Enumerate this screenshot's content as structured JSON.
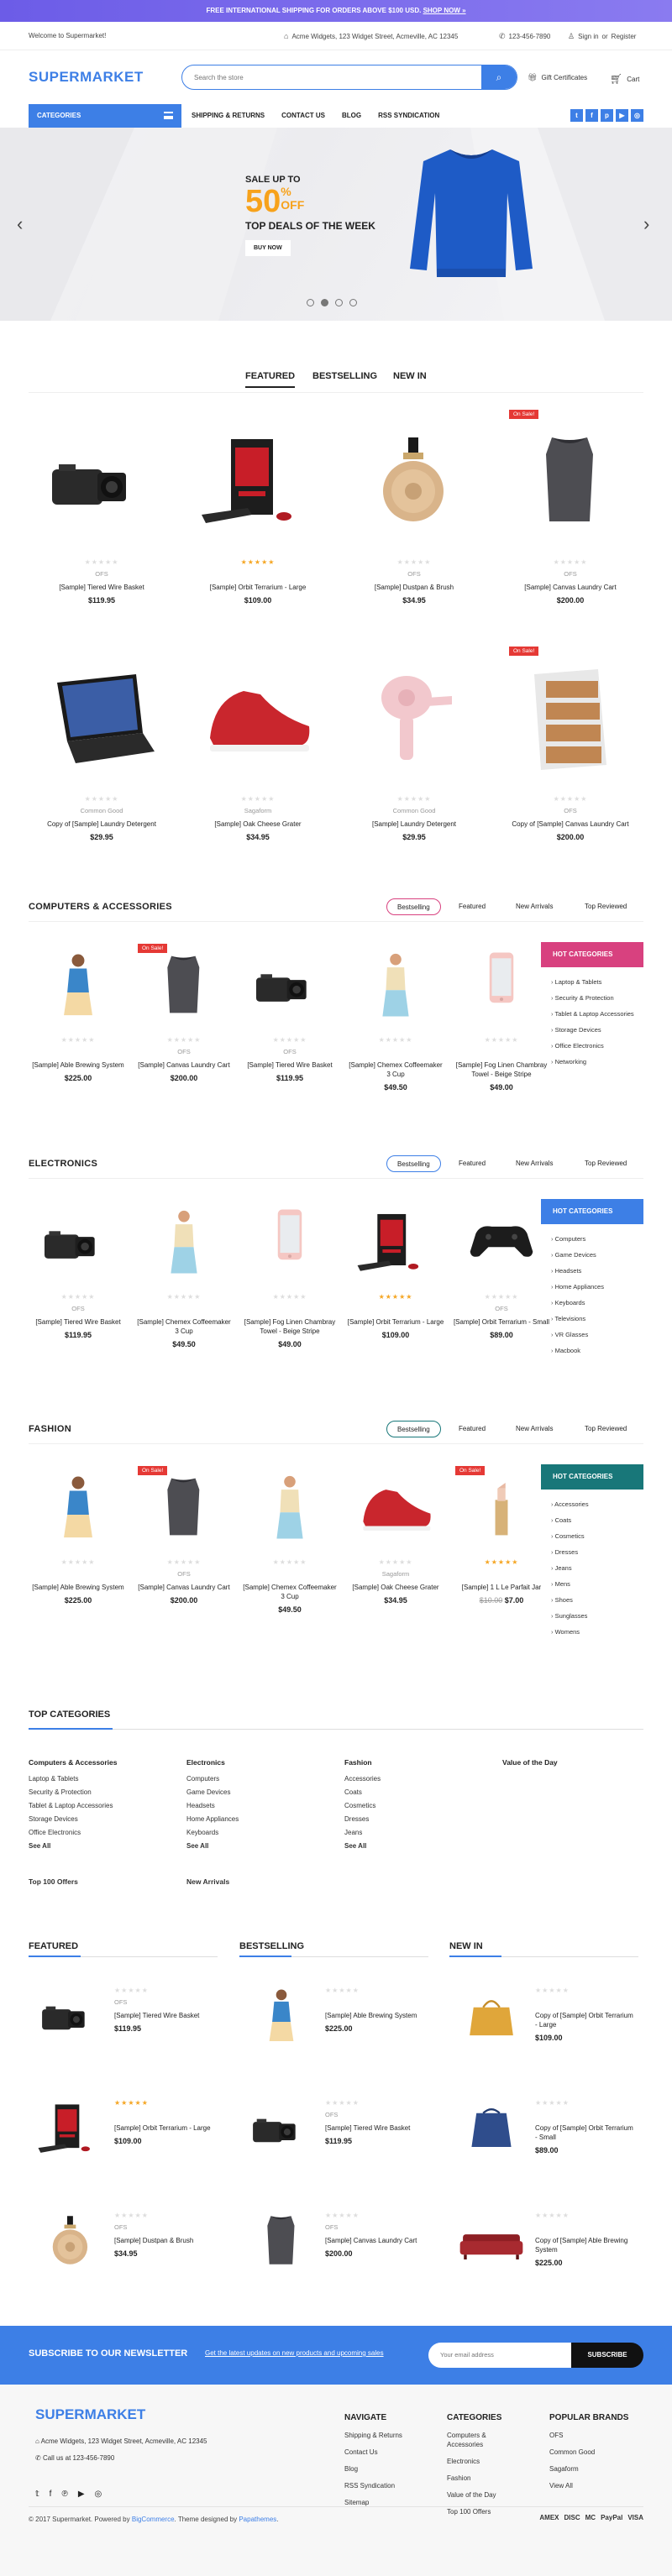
{
  "promo": {
    "text": "FREE INTERNATIONAL SHIPPING FOR ORDERS ABOVE $100 USD.",
    "link": "SHOP NOW »"
  },
  "topbar": {
    "welcome": "Welcome to Supermarket!",
    "address": "Acme Widgets, 123 Widget Street, Acmeville, AC 12345",
    "phone": "123-456-7890",
    "signin": "Sign in",
    "or": "or",
    "register": "Register"
  },
  "header": {
    "logo": "SUPERMARKET",
    "search_placeholder": "Search the store",
    "gift": "Gift Certificates"
  },
  "nav": {
    "categories": "CATEGORIES",
    "links": [
      "SHIPPING & RETURNS",
      "CONTACT US",
      "BLOG",
      "RSS SYNDICATION"
    ]
  },
  "hero": {
    "line1": "SALE UP TO",
    "pct": "50",
    "percent": "%",
    "off": "OFF",
    "line3": "TOP DEALS OF THE WEEK",
    "btn": "BUY NOW"
  },
  "tabs": [
    "FEATURED",
    "BESTSELLING",
    "NEW IN"
  ],
  "featured": [
    {
      "brand": "OFS",
      "name": "[Sample] Tiered Wire Basket",
      "price": "$119.95",
      "stars": "★★★★★",
      "starcolor": "grey",
      "img": "camera",
      "sale": ""
    },
    {
      "brand": "",
      "name": "[Sample] Orbit Terrarium - Large",
      "price": "$109.00",
      "stars": "★★★★★",
      "starcolor": "yellow",
      "img": "pc",
      "sale": ""
    },
    {
      "brand": "OFS",
      "name": "[Sample] Dustpan & Brush",
      "price": "$34.95",
      "stars": "★★★★★",
      "starcolor": "grey",
      "img": "perfume",
      "sale": ""
    },
    {
      "brand": "OFS",
      "name": "[Sample] Canvas Laundry Cart",
      "price": "$200.00",
      "stars": "★★★★★",
      "starcolor": "grey",
      "img": "shirt",
      "sale": "On Sale!"
    },
    {
      "brand": "Common Good",
      "name": "Copy of [Sample] Laundry Detergent",
      "price": "$29.95",
      "stars": "★★★★★",
      "starcolor": "grey",
      "img": "laptop",
      "sale": ""
    },
    {
      "brand": "Sagaform",
      "name": "[Sample] Oak Cheese Grater",
      "price": "$34.95",
      "stars": "★★★★★",
      "starcolor": "grey",
      "img": "shoe",
      "sale": ""
    },
    {
      "brand": "Common Good",
      "name": "[Sample] Laundry Detergent",
      "price": "$29.95",
      "stars": "★★★★★",
      "starcolor": "grey",
      "img": "dryer",
      "sale": ""
    },
    {
      "brand": "OFS",
      "name": "Copy of [Sample] Canvas Laundry Cart",
      "price": "$200.00",
      "stars": "★★★★★",
      "starcolor": "grey",
      "img": "drawers",
      "sale": "On Sale!"
    }
  ],
  "filters": [
    "Bestselling",
    "Featured",
    "New Arrivals",
    "Top Reviewed"
  ],
  "sections": [
    {
      "title": "COMPUTERS & ACCESSORIES",
      "color": "#d8417f",
      "box_title": "HOT CATEGORIES",
      "products": [
        {
          "brand": "",
          "name": "[Sample] Able Brewing System",
          "price": "$225.00",
          "old": "",
          "img": "woman",
          "sale": "",
          "starcolor": "grey"
        },
        {
          "brand": "OFS",
          "name": "[Sample] Canvas Laundry Cart",
          "price": "$200.00",
          "old": "",
          "img": "shirt",
          "sale": "On Sale!",
          "starcolor": "grey"
        },
        {
          "brand": "OFS",
          "name": "[Sample] Tiered Wire Basket",
          "price": "$119.95",
          "old": "",
          "img": "camera",
          "sale": "",
          "starcolor": "grey"
        },
        {
          "brand": "",
          "name": "[Sample] Chemex Coffeemaker 3 Cup",
          "price": "$49.50",
          "old": "",
          "img": "woman2",
          "sale": "",
          "starcolor": "grey"
        },
        {
          "brand": "",
          "name": "[Sample] Fog Linen Chambray Towel - Beige Stripe",
          "price": "$49.00",
          "old": "",
          "img": "phone",
          "sale": "",
          "starcolor": "grey"
        }
      ],
      "cats": [
        "Laptop & Tablets",
        "Security & Protection",
        "Tablet & Laptop Accessories",
        "Storage Devices",
        "Office Electronics",
        "Networking"
      ]
    },
    {
      "title": "ELECTRONICS",
      "color": "#3d7fe6",
      "box_title": "HOT CATEGORIES",
      "products": [
        {
          "brand": "OFS",
          "name": "[Sample] Tiered Wire Basket",
          "price": "$119.95",
          "old": "",
          "img": "camera",
          "sale": "",
          "starcolor": "grey"
        },
        {
          "brand": "",
          "name": "[Sample] Chemex Coffeemaker 3 Cup",
          "price": "$49.50",
          "old": "",
          "img": "woman2",
          "sale": "",
          "starcolor": "grey"
        },
        {
          "brand": "",
          "name": "[Sample] Fog Linen Chambray Towel - Beige Stripe",
          "price": "$49.00",
          "old": "",
          "img": "phone",
          "sale": "",
          "starcolor": "grey"
        },
        {
          "brand": "",
          "name": "[Sample] Orbit Terrarium - Large",
          "price": "$109.00",
          "old": "",
          "img": "pc",
          "sale": "",
          "starcolor": "yellow"
        },
        {
          "brand": "OFS",
          "name": "[Sample] Orbit Terrarium - Small",
          "price": "$89.00",
          "old": "",
          "img": "gamepad",
          "sale": "",
          "starcolor": "grey"
        }
      ],
      "cats": [
        "Computers",
        "Game Devices",
        "Headsets",
        "Home Appliances",
        "Keyboards",
        "Televisions",
        "VR Glasses",
        "Macbook"
      ]
    },
    {
      "title": "FASHION",
      "color": "#187779",
      "box_title": "HOT CATEGORIES",
      "products": [
        {
          "brand": "",
          "name": "[Sample] Able Brewing System",
          "price": "$225.00",
          "old": "",
          "img": "woman",
          "sale": "",
          "starcolor": "grey"
        },
        {
          "brand": "OFS",
          "name": "[Sample] Canvas Laundry Cart",
          "price": "$200.00",
          "old": "",
          "img": "shirt",
          "sale": "On Sale!",
          "starcolor": "grey"
        },
        {
          "brand": "",
          "name": "[Sample] Chemex Coffeemaker 3 Cup",
          "price": "$49.50",
          "old": "",
          "img": "woman2",
          "sale": "",
          "starcolor": "grey"
        },
        {
          "brand": "Sagaform",
          "name": "[Sample] Oak Cheese Grater",
          "price": "$34.95",
          "old": "",
          "img": "shoe",
          "sale": "",
          "starcolor": "grey"
        },
        {
          "brand": "",
          "name": "[Sample] 1 L Le Parfait Jar",
          "price": "$7.00",
          "old": "$10.00",
          "img": "lipstick",
          "sale": "On Sale!",
          "starcolor": "yellow"
        }
      ],
      "cats": [
        "Accessories",
        "Coats",
        "Cosmetics",
        "Dresses",
        "Jeans",
        "Mens",
        "Shoes",
        "Sunglasses",
        "Womens"
      ]
    }
  ],
  "topcats": {
    "title": "TOP CATEGORIES",
    "cols": [
      {
        "h": "Computers & Accessories",
        "items": [
          "Laptop & Tablets",
          "Security & Protection",
          "Tablet & Laptop Accessories",
          "Storage Devices",
          "Office Electronics"
        ],
        "see": "See All"
      },
      {
        "h": "Electronics",
        "items": [
          "Computers",
          "Game Devices",
          "Headsets",
          "Home Appliances",
          "Keyboards"
        ],
        "see": "See All"
      },
      {
        "h": "Fashion",
        "items": [
          "Accessories",
          "Coats",
          "Cosmetics",
          "Dresses",
          "Jeans"
        ],
        "see": "See All"
      },
      {
        "h": "Value of the Day",
        "items": [],
        "see": ""
      }
    ],
    "extra": [
      "Top 100 Offers",
      "New Arrivals"
    ]
  },
  "lists": [
    {
      "title": "FEATURED",
      "items": [
        {
          "brand": "OFS",
          "name": "[Sample] Tiered Wire Basket",
          "price": "$119.95",
          "img": "camera",
          "starcolor": "grey"
        },
        {
          "brand": "",
          "name": "[Sample] Orbit Terrarium - Large",
          "price": "$109.00",
          "img": "pc",
          "starcolor": "yellow"
        },
        {
          "brand": "OFS",
          "name": "[Sample] Dustpan & Brush",
          "price": "$34.95",
          "img": "perfume",
          "starcolor": "grey"
        }
      ]
    },
    {
      "title": "BESTSELLING",
      "items": [
        {
          "brand": "",
          "name": "[Sample] Able Brewing System",
          "price": "$225.00",
          "img": "woman",
          "starcolor": "grey"
        },
        {
          "brand": "OFS",
          "name": "[Sample] Tiered Wire Basket",
          "price": "$119.95",
          "img": "camera",
          "starcolor": "grey"
        },
        {
          "brand": "OFS",
          "name": "[Sample] Canvas Laundry Cart",
          "price": "$200.00",
          "img": "shirt",
          "starcolor": "grey"
        }
      ]
    },
    {
      "title": "NEW IN",
      "items": [
        {
          "brand": "",
          "name": "Copy of [Sample] Orbit Terrarium - Large",
          "price": "$109.00",
          "img": "bag",
          "starcolor": "grey"
        },
        {
          "brand": "",
          "name": "Copy of [Sample] Orbit Terrarium - Small",
          "price": "$89.00",
          "img": "bag2",
          "starcolor": "grey"
        },
        {
          "brand": "",
          "name": "Copy of [Sample] Able Brewing System",
          "price": "$225.00",
          "img": "sofa",
          "starcolor": "grey"
        }
      ]
    }
  ],
  "newsletter": {
    "title": "SUBSCRIBE TO OUR NEWSLETTER",
    "desc": "Get the latest updates on new products and upcoming sales",
    "placeholder": "Your email address",
    "btn": "SUBSCRIBE"
  },
  "footer": {
    "logo": "SUPERMARKET",
    "address": "Acme Widgets, 123 Widget Street, Acmeville, AC 12345",
    "call": "Call us at 123-456-7890",
    "navigate": {
      "h": "NAVIGATE",
      "items": [
        "Shipping & Returns",
        "Contact Us",
        "Blog",
        "RSS Syndication",
        "Sitemap"
      ]
    },
    "categories": {
      "h": "CATEGORIES",
      "items": [
        "Computers & Accessories",
        "Electronics",
        "Fashion",
        "Value of the Day",
        "Top 100 Offers"
      ]
    },
    "brands": {
      "h": "POPULAR BRANDS",
      "items": [
        "OFS",
        "Common Good",
        "Sagaform",
        "View All"
      ]
    },
    "copy_a": "© 2017 Supermarket. Powered by ",
    "copy_b": "BigCommerce",
    "copy_c": ". Theme designed by ",
    "copy_d": "Papathemes",
    "copy_e": ".",
    "payments": [
      "AMEX",
      "DISC",
      "MC",
      "PayPal",
      "VISA"
    ]
  }
}
